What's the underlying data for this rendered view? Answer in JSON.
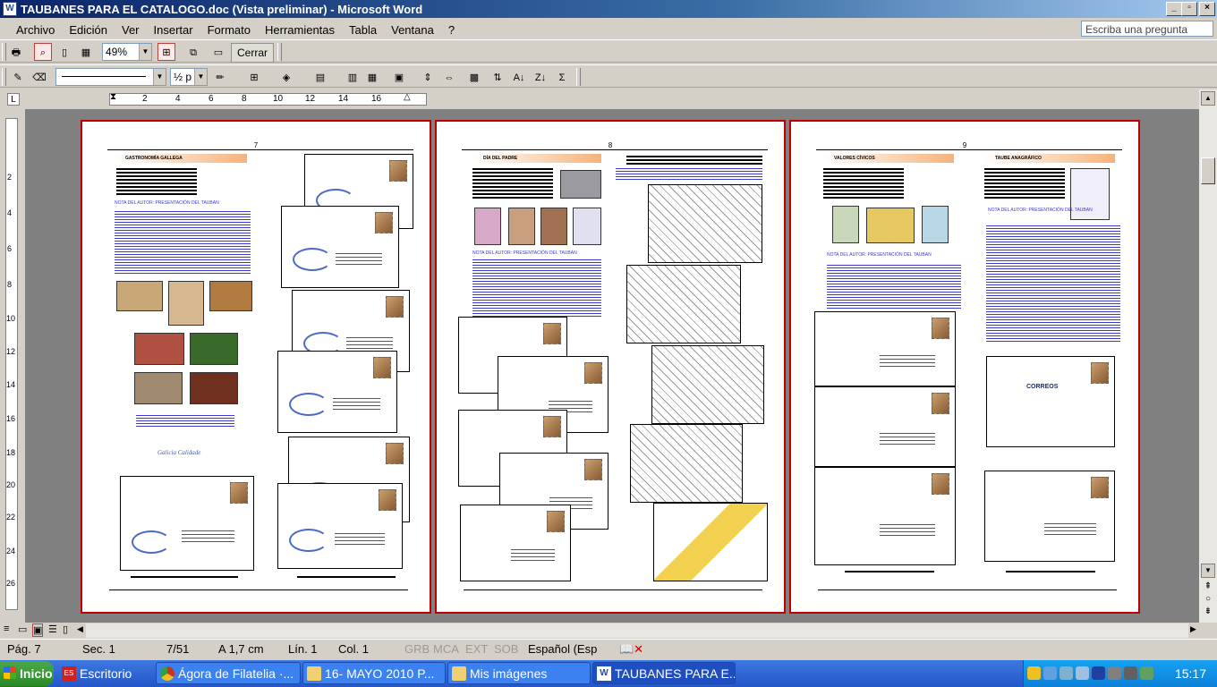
{
  "window": {
    "title": "TAUBANES PARA EL CATALOGO.doc (Vista preliminar) - Microsoft Word",
    "app_icon": "W"
  },
  "menu": {
    "items": [
      "Archivo",
      "Edición",
      "Ver",
      "Insertar",
      "Formato",
      "Herramientas",
      "Tabla",
      "Ventana",
      "?"
    ],
    "ask_placeholder": "Escriba una pregunta"
  },
  "toolbar": {
    "zoom": "49%",
    "close_label": "Cerrar",
    "line_weight": "½ p",
    "sigma": "Σ"
  },
  "ruler": {
    "h_ticks": [
      "2",
      "4",
      "6",
      "8",
      "10",
      "12",
      "14",
      "16"
    ],
    "v_ticks": [
      "2",
      "4",
      "6",
      "8",
      "10",
      "12",
      "14",
      "16",
      "18",
      "20",
      "22",
      "24",
      "26"
    ]
  },
  "pages": [
    {
      "number": "7",
      "header": "GASTRONOMÍA GALLEGA",
      "note": "NOTA DEL AUTOR: PRESENTACIÓN DEL TAUBAN",
      "caption": "Galicia Calidade"
    },
    {
      "number": "8",
      "header": "DÍA DEL PADRE",
      "note": "NOTA DEL AUTOR: PRESENTACIÓN DEL TAUBAN"
    },
    {
      "number": "9",
      "header_left": "VALORES CÍVICOS",
      "header_right": "TAUBE ANAGRÁFICO",
      "note": "NOTA DEL AUTOR: PRESENTACIÓN DEL TAUBAN",
      "stamp_word": "CORREOS"
    }
  ],
  "status": {
    "page": "Pág. 7",
    "section": "Sec. 1",
    "count": "7/51",
    "at": "A 1,7 cm",
    "line": "Lín. 1",
    "col": "Col. 1",
    "grb": "GRB",
    "mca": "MCA",
    "ext": "EXT",
    "sob": "SOB",
    "language": "Español (Esp"
  },
  "taskbar": {
    "start": "Inicio",
    "tasks": [
      {
        "label": "Escritorio",
        "icon": "es-icon"
      },
      {
        "label": "Ágora de Filatelia ·...",
        "icon": "chrome-icon"
      },
      {
        "label": "16- MAYO 2010  P...",
        "icon": "folder-icon"
      },
      {
        "label": "Mis imágenes",
        "icon": "folder-icon"
      },
      {
        "label": "TAUBANES PARA E...",
        "icon": "word-icon"
      }
    ],
    "clock": "15:17"
  },
  "colors": {
    "title_bar": "#0a246a",
    "page_border": "#c00000",
    "workspace": "#808080",
    "taskbar": "#2456c8",
    "start": "#2a8a28"
  }
}
